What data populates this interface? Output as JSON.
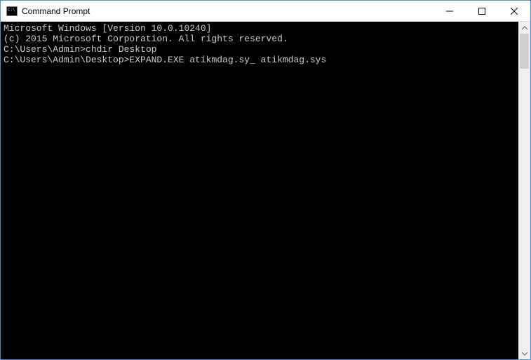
{
  "window": {
    "title": "Command Prompt"
  },
  "terminal": {
    "lines": [
      "Microsoft Windows [Version 10.0.10240]",
      "(c) 2015 Microsoft Corporation. All rights reserved.",
      "",
      "C:\\Users\\Admin>chdir Desktop",
      "",
      "C:\\Users\\Admin\\Desktop>EXPAND.EXE atikmdag.sy_ atikmdag.sys"
    ]
  }
}
